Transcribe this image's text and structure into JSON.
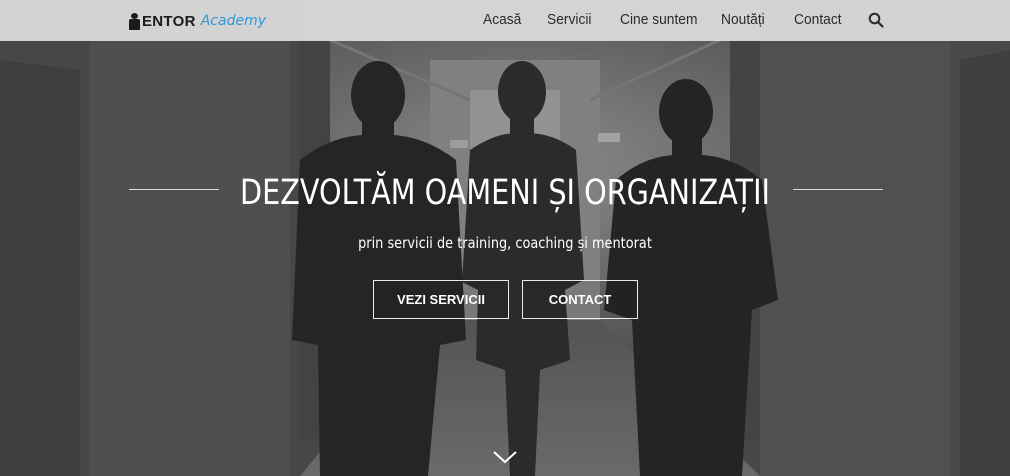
{
  "brand": {
    "name": "ENTOR",
    "accent": "Academy",
    "accent_color": "#2f97d6"
  },
  "nav": {
    "items": [
      {
        "label": "Acasă"
      },
      {
        "label": "Servicii"
      },
      {
        "label": "Cine suntem"
      },
      {
        "label": "Noutăți"
      },
      {
        "label": "Contact"
      }
    ],
    "search_icon": "search-icon"
  },
  "hero": {
    "title": "DEZVOLTĂM OAMENI ȘI ORGANIZAȚII",
    "subtitle": "prin servicii de training, coaching și mentorat",
    "buttons": [
      {
        "label": "VEZI SERVICII"
      },
      {
        "label": "CONTACT"
      }
    ],
    "scroll_icon": "chevron-down-icon"
  }
}
